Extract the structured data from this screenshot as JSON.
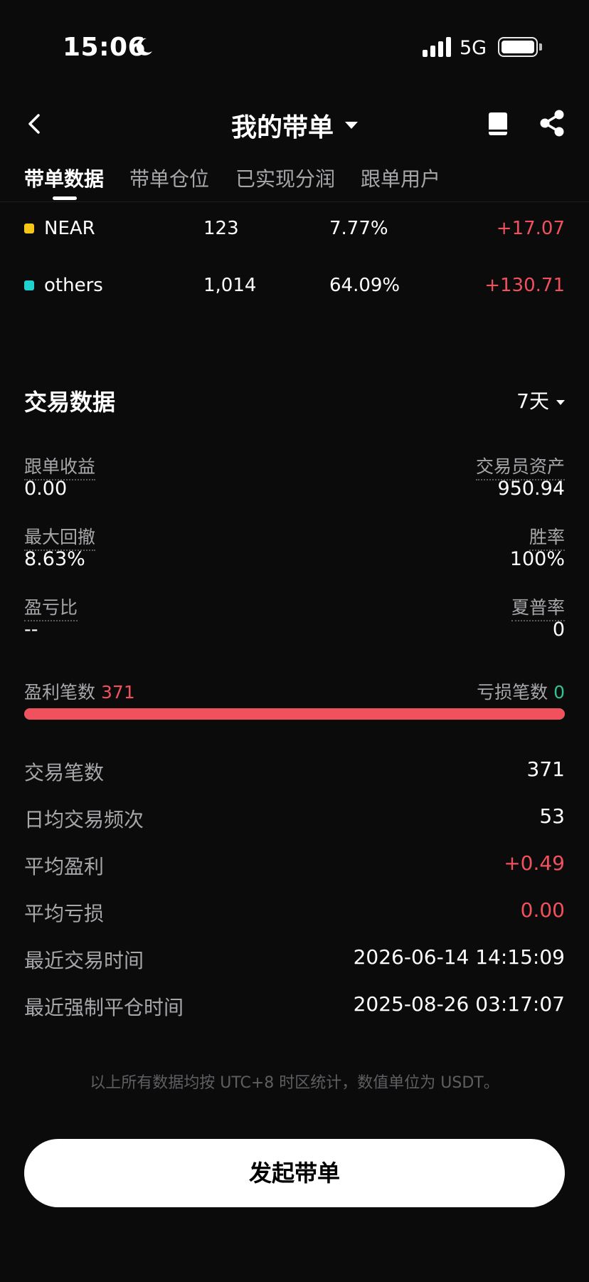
{
  "status_bar": {
    "time": "15:06",
    "network": "5G"
  },
  "header": {
    "title": "我的带单"
  },
  "tabs": [
    {
      "label": "带单数据"
    },
    {
      "label": "带单仓位"
    },
    {
      "label": "已实现分润"
    },
    {
      "label": "跟单用户"
    }
  ],
  "holdings": [
    {
      "name": "NEAR",
      "count": "123",
      "percent": "7.77%",
      "pnl": "+17.07",
      "color": "#f5c518"
    },
    {
      "name": "others",
      "count": "1,014",
      "percent": "64.09%",
      "pnl": "+130.71",
      "color": "#1fd1cf"
    }
  ],
  "trading": {
    "title": "交易数据",
    "period": "7天",
    "metrics": {
      "copy_profit_label": "跟单收益",
      "copy_profit_value": "0.00",
      "trader_assets_label": "交易员资产",
      "trader_assets_value": "950.94",
      "max_drawdown_label": "最大回撤",
      "max_drawdown_value": "8.63%",
      "win_rate_label": "胜率",
      "win_rate_value": "100%",
      "pl_ratio_label": "盈亏比",
      "pl_ratio_value": "--",
      "sharpe_label": "夏普率",
      "sharpe_value": "0"
    },
    "win_count_label": "盈利笔数",
    "win_count": "371",
    "loss_count_label": "亏损笔数",
    "loss_count": "0",
    "win_fraction": 1.0,
    "stats": [
      {
        "label": "交易笔数",
        "value": "371",
        "red": false
      },
      {
        "label": "日均交易频次",
        "value": "53",
        "red": false
      },
      {
        "label": "平均盈利",
        "value": "+0.49",
        "red": true
      },
      {
        "label": "平均亏损",
        "value": "0.00",
        "red": true
      },
      {
        "label": "最近交易时间",
        "value": "2026-06-14 14:15:09",
        "red": false
      },
      {
        "label": "最近强制平仓时间",
        "value": "2025-08-26 03:17:07",
        "red": false
      }
    ]
  },
  "footnote": "以上所有数据均按 UTC+8 时区统计，数值单位为 USDT。",
  "cta_label": "发起带单",
  "colors": {
    "up": "#f0515c",
    "down": "#34c38f",
    "background": "#0b0b0c"
  }
}
